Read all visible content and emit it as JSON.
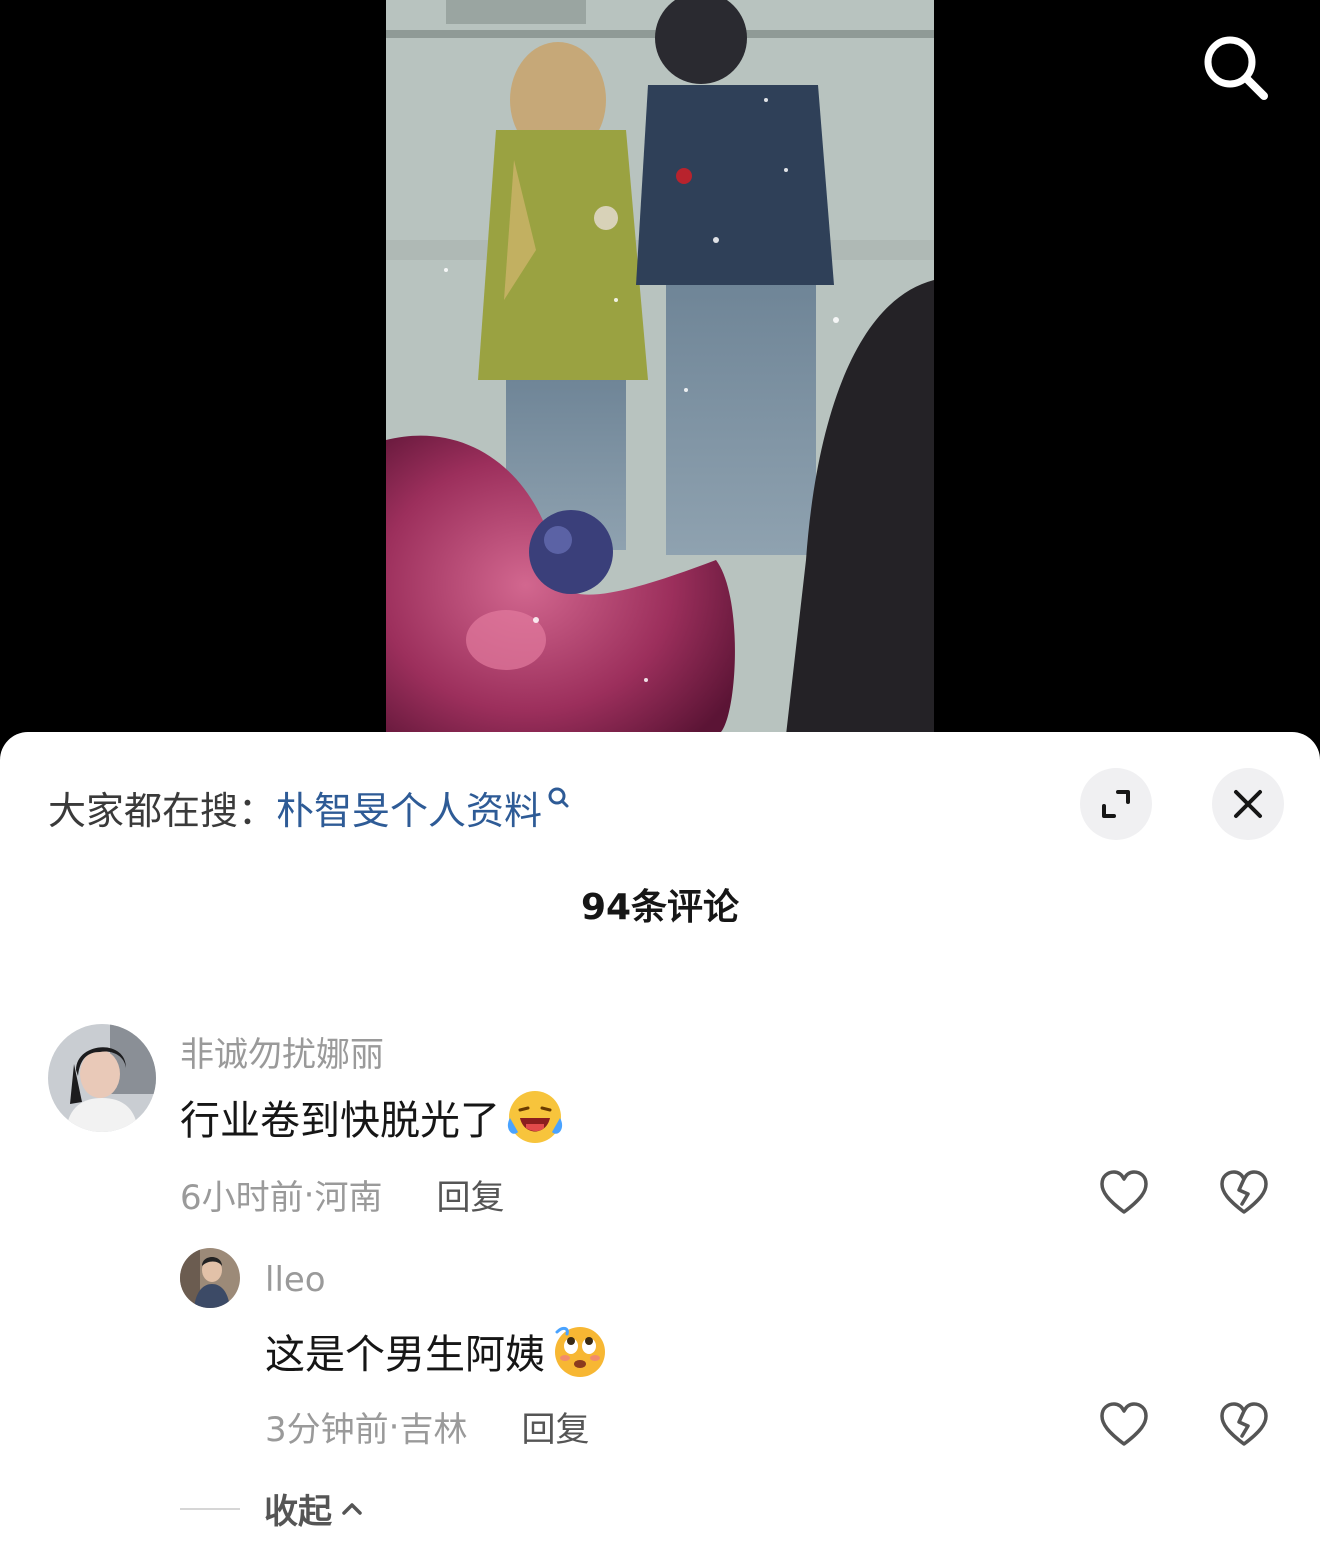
{
  "hot_search": {
    "prefix": "大家都在搜：",
    "query": "朴智旻个人资料"
  },
  "comment_count_label": "94条评论",
  "comments": [
    {
      "username": "非诚勿扰娜丽",
      "text": "行业卷到快脱光了",
      "emoji": "laughing-crying-emoji",
      "time": "6小时前",
      "location": "河南",
      "reply_label": "回复",
      "replies": [
        {
          "username": "lleo",
          "text": "这是个男生阿姨",
          "emoji": "eye-roll-emoji",
          "time": "3分钟前",
          "location": "吉林",
          "reply_label": "回复"
        }
      ]
    }
  ],
  "collapse_label": "收起",
  "separator": " · ",
  "colors": {
    "link": "#2e5b96",
    "text": "#161616",
    "secondary": "#9a9a9a",
    "sheet_bg": "#ffffff"
  }
}
